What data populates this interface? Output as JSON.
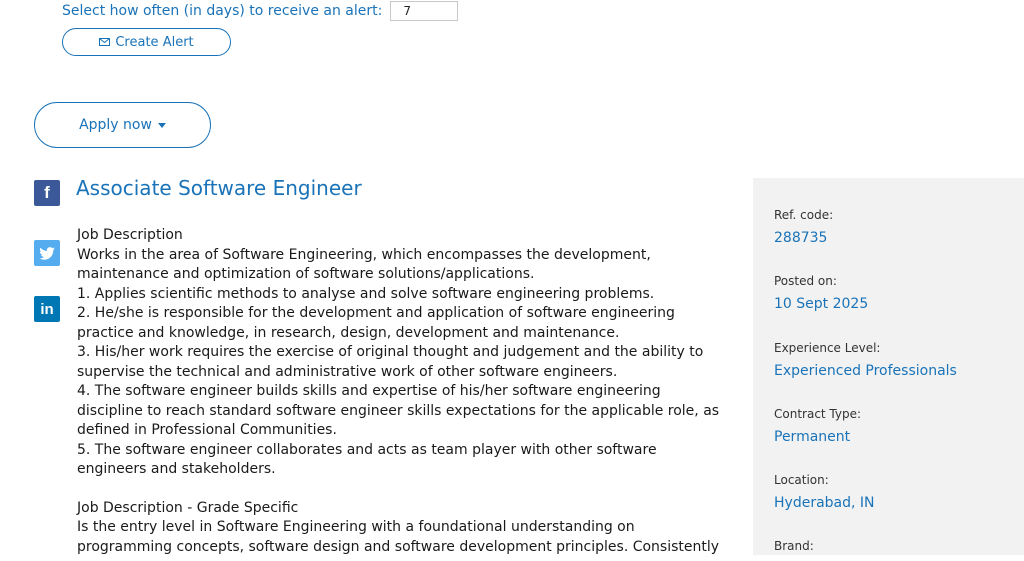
{
  "alert": {
    "label": "Select how often (in days) to receive an alert:",
    "days_value": "7",
    "create_label": "Create Alert"
  },
  "apply": {
    "label": "Apply now"
  },
  "job": {
    "title": "Associate Software Engineer",
    "description_lines": [
      "Job Description",
      "Works in the area of Software Engineering, which encompasses the development,",
      "maintenance and optimization of software solutions/applications.",
      "1. Applies scientific methods to analyse and solve software engineering problems.",
      "2. He/she is responsible for the development and application of software engineering",
      "practice and knowledge, in research, design, development and maintenance.",
      "3. His/her work requires the exercise of original thought and judgement and the ability to",
      "supervise the technical and administrative work of other software engineers.",
      "4. The software engineer builds skills and expertise of his/her software engineering",
      "discipline to reach standard software engineer skills expectations for the applicable role, as",
      "defined in Professional Communities.",
      "5. The software engineer collaborates and acts as team player with other software",
      "engineers and stakeholders.",
      "",
      "Job Description - Grade Specific",
      "Is the entry level in Software Engineering with a foundational understanding on",
      "programming concepts, software design and software development principles. Consistently"
    ]
  },
  "social": {
    "facebook": "f",
    "linkedin": "in"
  },
  "sidebar": {
    "ref_label": "Ref. code:",
    "ref_value": "288735",
    "posted_label": "Posted on:",
    "posted_value": "10 Sept 2025",
    "experience_label": "Experience Level:",
    "experience_value": "Experienced Professionals",
    "contract_label": "Contract Type:",
    "contract_value": "Permanent",
    "location_label": "Location:",
    "location_value": "Hyderabad, IN",
    "brand_label": "Brand:"
  },
  "colors": {
    "accent": "#1a73b8",
    "sidebar_bg": "#f2f2f2",
    "facebook": "#3b5998",
    "twitter": "#55acee",
    "linkedin": "#0077b5"
  }
}
